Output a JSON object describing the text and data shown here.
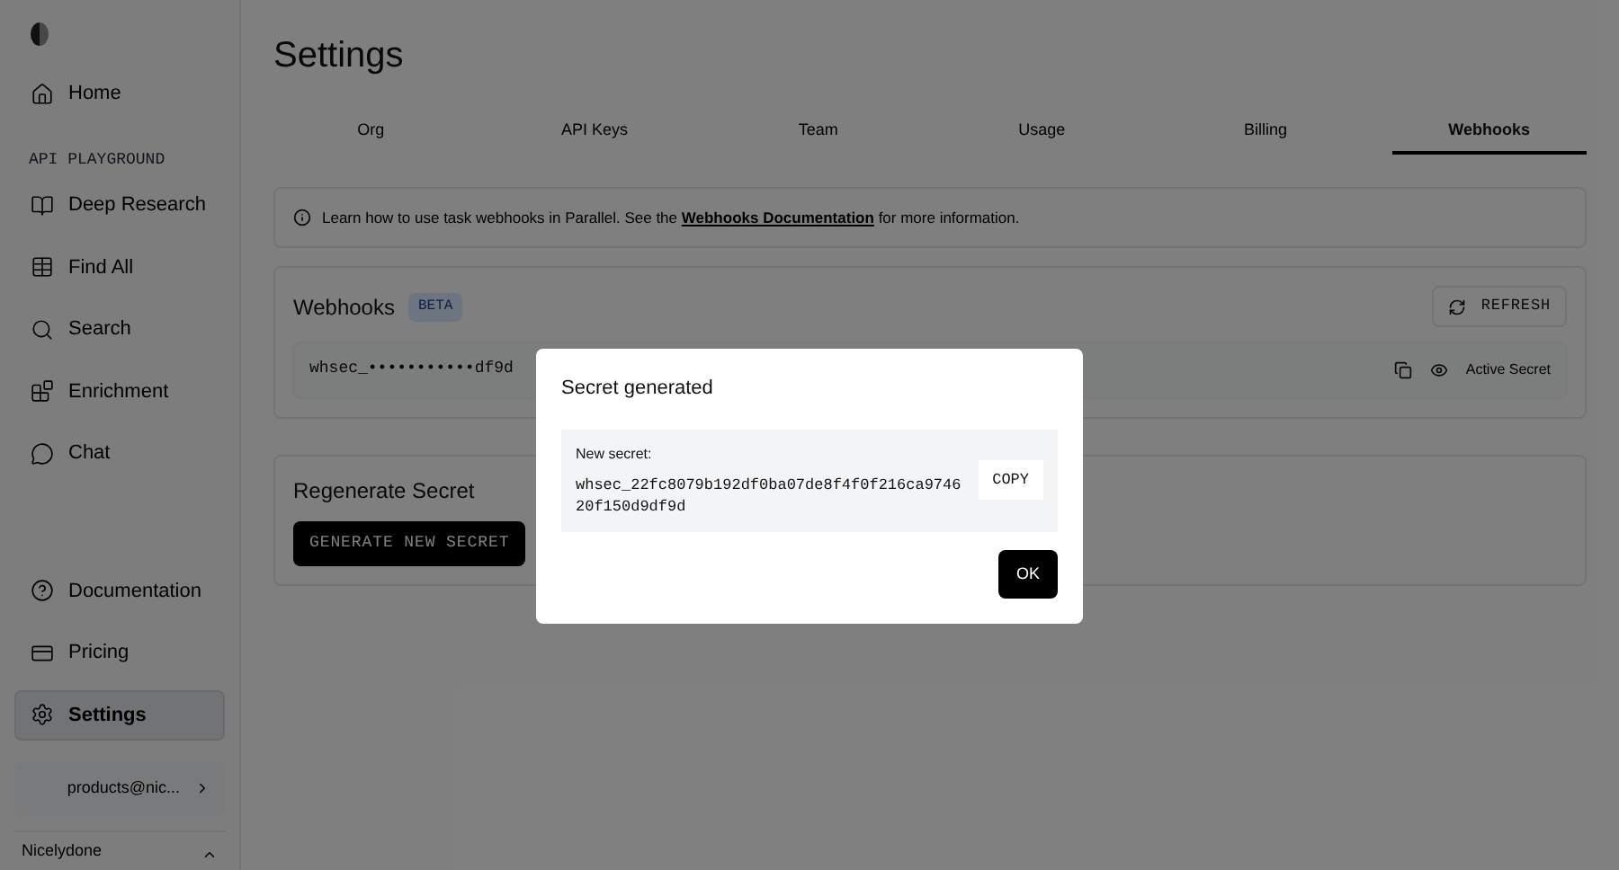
{
  "sidebar": {
    "nav_top": [
      {
        "label": "Home",
        "selected": false
      }
    ],
    "section_label": "API PLAYGROUND",
    "playground": [
      {
        "label": "Deep Research",
        "selected": false
      },
      {
        "label": "Find All",
        "selected": false
      },
      {
        "label": "Search",
        "selected": false
      },
      {
        "label": "Enrichment",
        "selected": false
      },
      {
        "label": "Chat",
        "selected": false
      }
    ],
    "nav_bottom": [
      {
        "label": "Documentation",
        "selected": false
      },
      {
        "label": "Pricing",
        "selected": false
      },
      {
        "label": "Settings",
        "selected": true
      }
    ],
    "account_email": "products@nic...",
    "user_name": "Nicelydone"
  },
  "page": {
    "title": "Settings",
    "tabs": [
      {
        "label": "Org",
        "selected": false
      },
      {
        "label": "API Keys",
        "selected": false
      },
      {
        "label": "Team",
        "selected": false
      },
      {
        "label": "Usage",
        "selected": false
      },
      {
        "label": "Billing",
        "selected": false
      },
      {
        "label": "Webhooks",
        "selected": true
      }
    ],
    "info": {
      "before": "Learn how to use task webhooks in Parallel. See the",
      "link": "Webhooks Documentation",
      "after": "for more information."
    },
    "webhooks": {
      "title": "Webhooks",
      "badge": "BETA",
      "refresh": "REFRESH",
      "secret_masked": "whsec_•••••••••••df9d",
      "secret_status": "Active Secret"
    },
    "regenerate": {
      "title": "Regenerate Secret",
      "button": "GENERATE NEW SECRET"
    }
  },
  "dialog": {
    "title": "Secret generated",
    "label": "New secret:",
    "secret": "whsec_22fc8079b192df0ba07de8f4f0f216ca974620f150d9df9d",
    "copy": "COPY",
    "ok": "OK"
  }
}
